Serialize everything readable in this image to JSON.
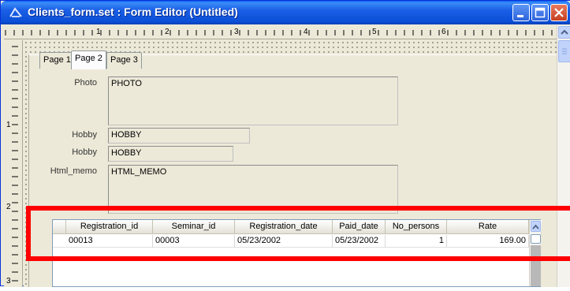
{
  "window": {
    "title": "Clients_form.set : Form Editor (Untitled)"
  },
  "ruler": {
    "h_numbers": [
      "1",
      "2",
      "3",
      "4",
      "5",
      "6"
    ],
    "v_numbers": [
      "1",
      "2",
      "3"
    ]
  },
  "tabs": [
    {
      "label": "Page 1",
      "active": false
    },
    {
      "label": "Page 2",
      "active": true
    },
    {
      "label": "Page 3",
      "active": false
    }
  ],
  "fields": {
    "photo": {
      "label": "Photo",
      "value": "PHOTO"
    },
    "hobby1": {
      "label": "Hobby",
      "value": "HOBBY"
    },
    "hobby2": {
      "label": "Hobby",
      "value": "HOBBY"
    },
    "html_memo": {
      "label": "Html_memo",
      "value": "HTML_MEMO"
    }
  },
  "grid": {
    "columns": [
      "Registration_id",
      "Seminar_id",
      "Registration_date",
      "Paid_date",
      "No_persons",
      "Rate"
    ],
    "rows": [
      [
        "00013",
        "00003",
        "05/23/2002",
        "05/23/2002",
        "1",
        "169.00"
      ]
    ]
  },
  "colors": {
    "titlebar": "#0b4fd6",
    "highlight": "#ff0000",
    "row_indicator": "#f0c060"
  }
}
